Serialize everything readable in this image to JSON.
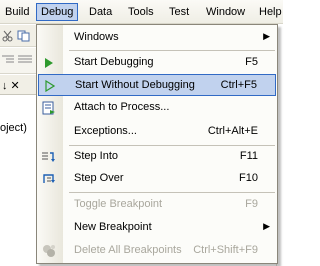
{
  "menubar": {
    "items": [
      {
        "label": "Build"
      },
      {
        "label": "Debug",
        "active": true
      },
      {
        "label": "Data"
      },
      {
        "label": "Tools"
      },
      {
        "label": "Test"
      },
      {
        "label": "Window"
      },
      {
        "label": "Help"
      }
    ]
  },
  "background": {
    "pin_glyph": "↓ ✕",
    "partial_text": "oject)"
  },
  "debug_menu": {
    "items": [
      {
        "label": "Windows",
        "shortcut": "",
        "submenu": true,
        "icon": "none"
      },
      {
        "label": "Start Debugging",
        "shortcut": "F5",
        "icon": "play-icon"
      },
      {
        "label": "Start Without Debugging",
        "shortcut": "Ctrl+F5",
        "icon": "play-outline-icon",
        "highlighted": true
      },
      {
        "label": "Attach to Process...",
        "shortcut": "",
        "icon": "attach-process-icon"
      },
      {
        "label": "Exceptions...",
        "shortcut": "Ctrl+Alt+E",
        "icon": "none"
      },
      {
        "label": "Step Into",
        "shortcut": "F11",
        "icon": "step-into-icon"
      },
      {
        "label": "Step Over",
        "shortcut": "F10",
        "icon": "step-over-icon"
      },
      {
        "label": "Toggle Breakpoint",
        "shortcut": "F9",
        "icon": "none",
        "disabled": true
      },
      {
        "label": "New Breakpoint",
        "shortcut": "",
        "submenu": true,
        "icon": "none"
      },
      {
        "label": "Delete All Breakpoints",
        "shortcut": "Ctrl+Shift+F9",
        "icon": "delete-breakpoints-icon",
        "disabled": true
      }
    ]
  },
  "colors": {
    "highlight_bg": "#c1d2ee",
    "highlight_border": "#316ac5",
    "play_green": "#2e9a2e",
    "disabled_text": "#a9a79d"
  }
}
